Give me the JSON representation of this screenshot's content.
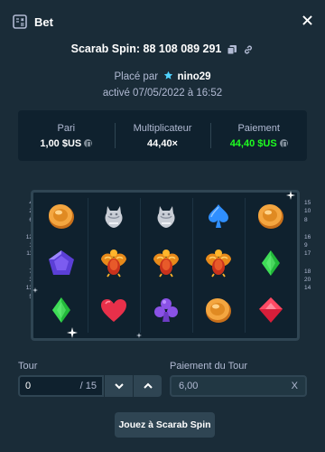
{
  "header": {
    "title": "Bet",
    "icon": "bet-slip-icon",
    "close_icon": "close-icon"
  },
  "game": {
    "title": "Scarab Spin: 88 108 089 291",
    "copy_icon": "copy-icon",
    "link_icon": "link-icon"
  },
  "placed": {
    "prefix": "Placé par",
    "user_icon": "star-icon",
    "username": "nino29"
  },
  "activated": "activé 07/05/2022 à 16:52",
  "stats": {
    "bet_label": "Pari",
    "bet_value": "1,00 $US",
    "multiplier_label": "Multiplicateur",
    "multiplier_value": "44,40×",
    "payout_label": "Paiement",
    "payout_value": "44,40 $US",
    "payout_color": "#1fff20"
  },
  "board": {
    "rows": [
      [
        "orange-coin",
        "silver-cat",
        "silver-cat",
        "blue-spade",
        "orange-coin"
      ],
      [
        "purple-pentagon",
        "scarab",
        "scarab",
        "scarab",
        "green-diamond"
      ],
      [
        "green-diamond",
        "red-heart",
        "purple-club",
        "orange-coin",
        "red-gem"
      ]
    ],
    "paylines_left": [
      [
        "4",
        "2",
        "6"
      ],
      [
        "12",
        "1",
        "11"
      ],
      [
        "7",
        "3",
        "13",
        "5"
      ]
    ],
    "paylines_right": [
      [
        "15",
        "10",
        "8"
      ],
      [
        "16",
        "9",
        "17"
      ],
      [
        "18",
        "20",
        "14"
      ]
    ]
  },
  "form": {
    "round_label": "Tour",
    "round_value": "0",
    "round_total": "/ 15",
    "round_payout_label": "Paiement du Tour",
    "round_payout_value": "6,00",
    "round_payout_suffix": "X"
  },
  "play_button": "Jouez à Scarab Spin"
}
